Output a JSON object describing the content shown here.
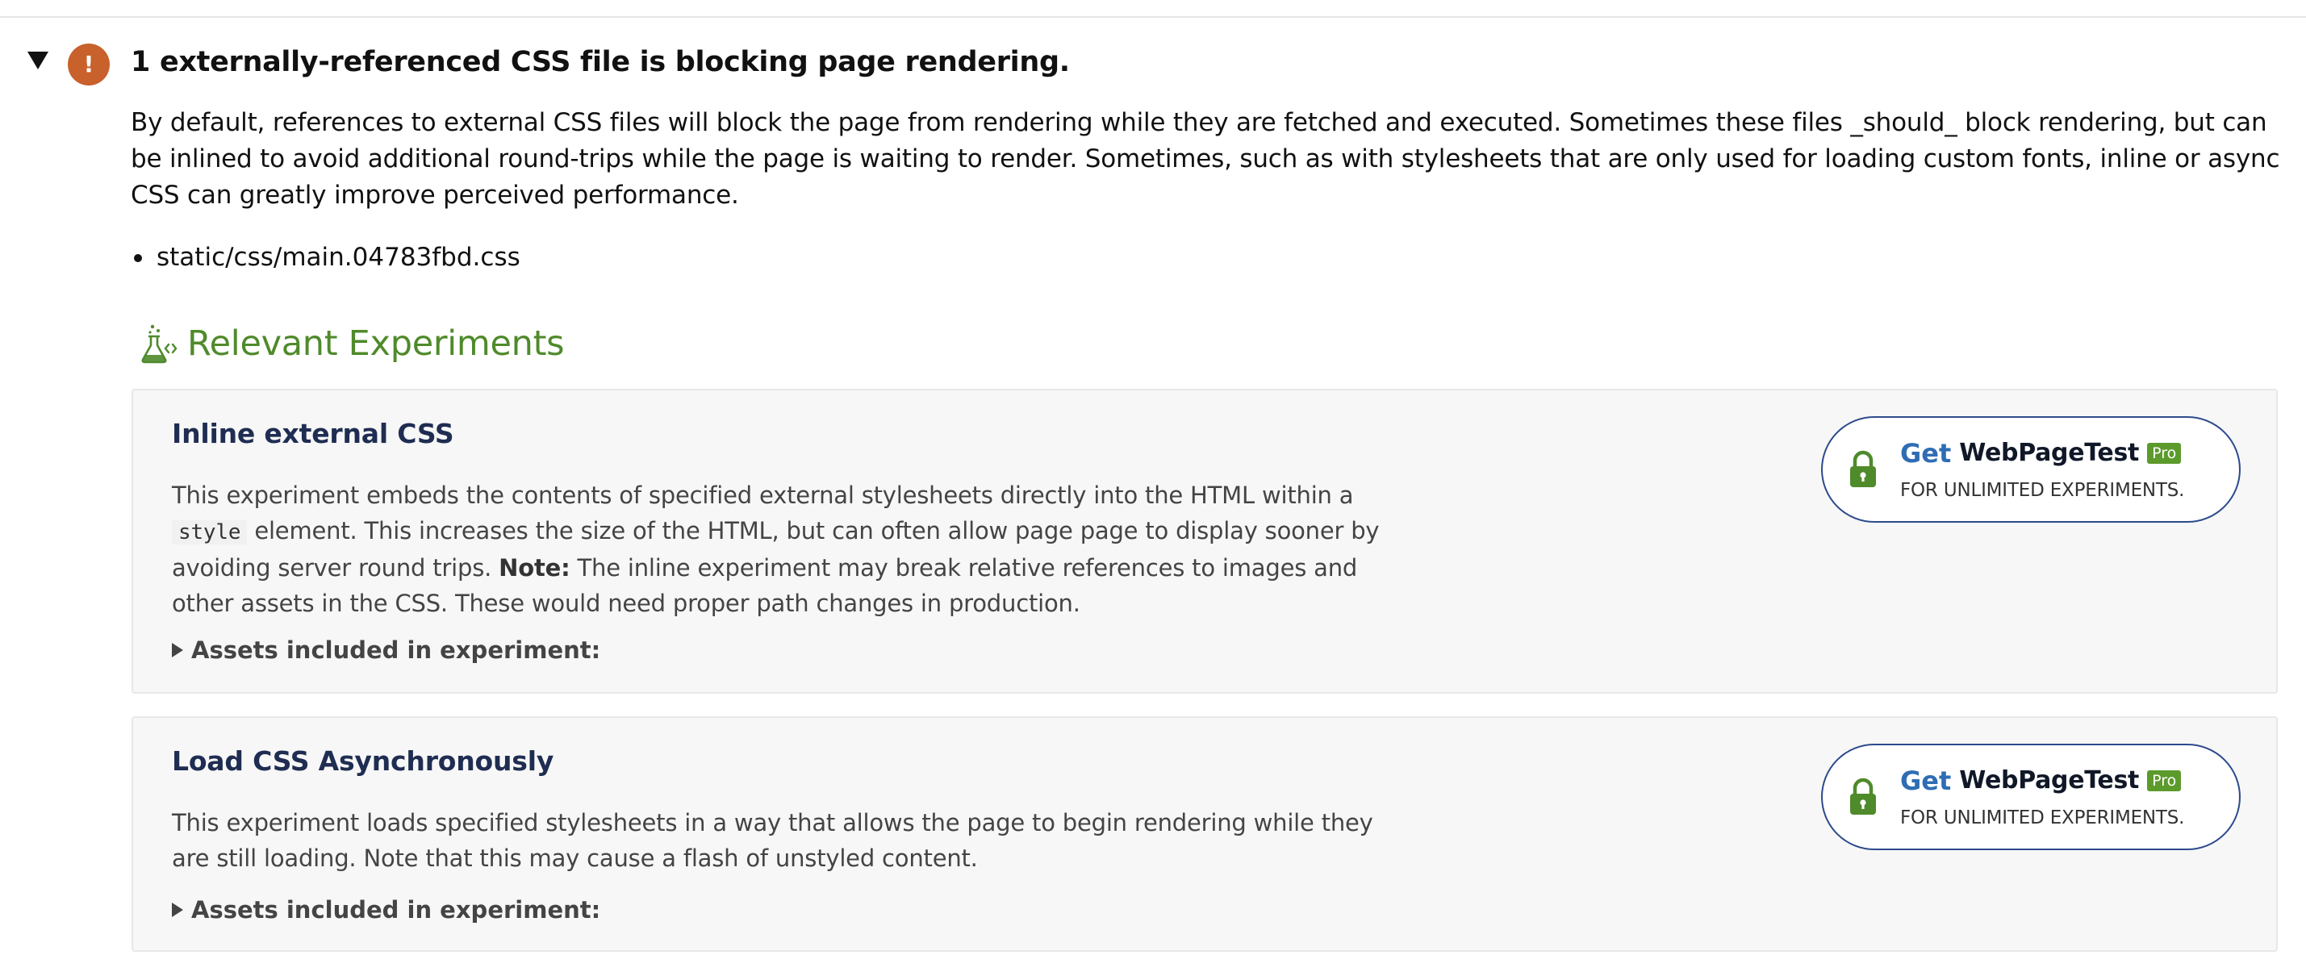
{
  "issue": {
    "warning_glyph": "!",
    "title": "1 externally-referenced CSS file is blocking page rendering.",
    "description": "By default, references to external CSS files will block the page from rendering while they are fetched and executed. Sometimes these files _should_ block rendering, but can be inlined to avoid additional round-trips while the page is waiting to render. Sometimes, such as with stylesheets that are only used for loading custom fonts, inline or async CSS can greatly improve perceived performance.",
    "files": [
      "static/css/main.04783fbd.css"
    ]
  },
  "experiments_section": {
    "title": "Relevant Experiments",
    "icon": "flask-icon",
    "accent_color": "#4f8a2b"
  },
  "experiments": [
    {
      "title": "Inline external CSS",
      "body_part1": "This experiment embeds the contents of specified external stylesheets directly into the HTML within a",
      "body_code": "style",
      "body_part2": "element. This increases the size of the HTML, but can often allow page page to display sooner by avoiding server round trips.",
      "body_note_label": "Note:",
      "body_part3": "The inline experiment may break relative references to images and other assets in the CSS. These would need proper path changes in production.",
      "assets_label": "Assets included in experiment:",
      "cta": {
        "get": "Get",
        "brand": "WebPageTest",
        "badge": "Pro",
        "subtitle": "FOR UNLIMITED EXPERIMENTS.",
        "icon": "lock-icon"
      }
    },
    {
      "title": "Load CSS Asynchronously",
      "body": "This experiment loads specified stylesheets in a way that allows the page to begin rendering while they are still loading. Note that this may cause a flash of unstyled content.",
      "assets_label": "Assets included in experiment:",
      "cta": {
        "get": "Get",
        "brand": "WebPageTest",
        "badge": "Pro",
        "subtitle": "FOR UNLIMITED EXPERIMENTS.",
        "icon": "lock-icon"
      }
    }
  ],
  "colors": {
    "warning": "#c8612b",
    "card_title": "#1f2d52",
    "cta_border": "#2c4a8c",
    "cta_get": "#2e6db4",
    "pro_badge": "#5c9a2b",
    "lock": "#4f8a2b"
  }
}
